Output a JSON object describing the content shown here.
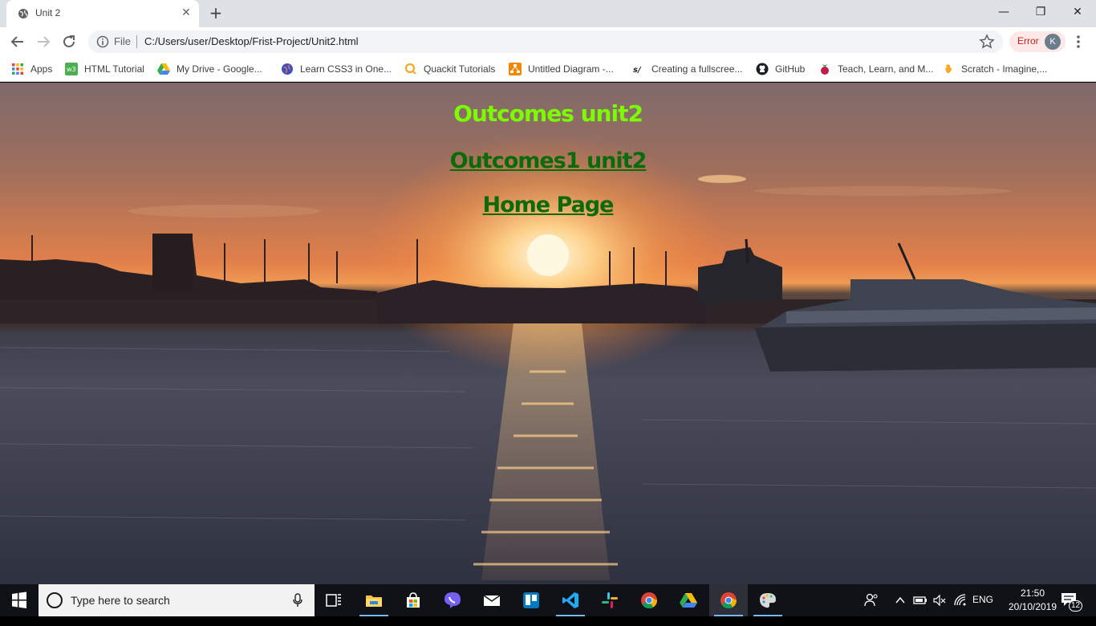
{
  "browser": {
    "tab": {
      "title": "Unit 2",
      "close": "✕"
    },
    "new_tab": "+",
    "window_controls": {
      "minimize": "—",
      "restore": "❐",
      "close": "✕"
    },
    "omnibox": {
      "scheme_label": "File",
      "url": "C:/Users/user/Desktop/Frist-Project/Unit2.html"
    },
    "profile": {
      "error_label": "Error",
      "avatar_initial": "K"
    },
    "bookmarks": [
      {
        "label": "Apps",
        "icon": "apps-grid-icon"
      },
      {
        "label": "HTML Tutorial",
        "icon": "w3-icon"
      },
      {
        "label": "My Drive - Google...",
        "icon": "google-drive-icon"
      },
      {
        "label": "Learn CSS3 in One...",
        "icon": "globe-icon"
      },
      {
        "label": "Quackit Tutorials",
        "icon": "quackit-icon"
      },
      {
        "label": "Untitled Diagram -...",
        "icon": "drawio-icon"
      },
      {
        "label": "Creating a fullscree...",
        "icon": "sj-icon"
      },
      {
        "label": "GitHub",
        "icon": "github-icon"
      },
      {
        "label": "Teach, Learn, and M...",
        "icon": "raspberry-pi-icon"
      },
      {
        "label": "Scratch - Imagine,...",
        "icon": "scratch-icon"
      }
    ]
  },
  "page": {
    "title": "Outcomes unit2",
    "link_outcomes1": "Outcomes1 unit2",
    "link_home": "Home Page"
  },
  "taskbar": {
    "search_placeholder": "Type here to search",
    "apps": [
      "task-view",
      "file-explorer",
      "store",
      "viber",
      "mail",
      "trello",
      "vscode",
      "slack",
      "chrome",
      "google-drive",
      "chrome-active",
      "paint"
    ],
    "tray": {
      "language": "ENG",
      "time": "21:50",
      "date": "20/10/2019",
      "notifications": "12"
    }
  }
}
